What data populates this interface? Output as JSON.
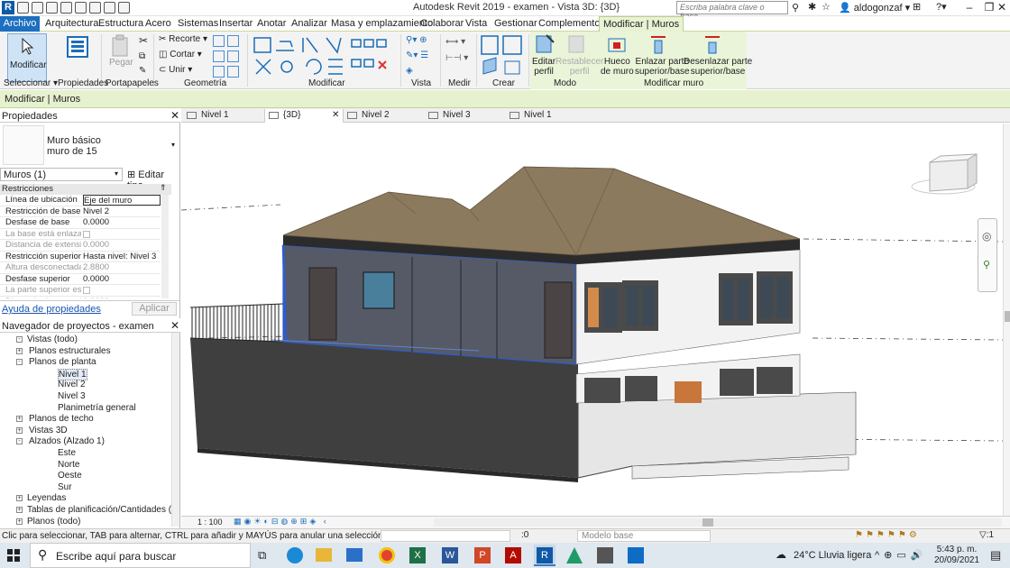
{
  "app": {
    "title": "Autodesk Revit 2019 - examen - Vista 3D: {3D}",
    "search_placeholder": "Escriba palabra clave o frase",
    "user": "aldogonzaf"
  },
  "menu": {
    "tabs": [
      "Archivo",
      "Arquitectura",
      "Estructura",
      "Acero",
      "Sistemas",
      "Insertar",
      "Anotar",
      "Analizar",
      "Masa y emplazamiento",
      "Colaborar",
      "Vista",
      "Gestionar",
      "Complementos",
      "Modificar | Muros"
    ],
    "active": "Modificar | Muros"
  },
  "ribbon": {
    "modificar_label": "Modificar",
    "pegar_label": "Pegar",
    "recorte_label": "Recorte",
    "cortar_label": "Cortar",
    "unir_label": "Unir",
    "editar_perfil": "Editar\nperfil",
    "restablecer_perfil": "Restablecer\nperfil",
    "hueco_muro": "Hueco\nde muro",
    "enlazar": "Enlazar parte\nsuperior/base",
    "desenlazar": "Desenlazar parte\nsuperior/base",
    "groups": {
      "seleccionar": "Seleccionar",
      "propiedades": "Propiedades",
      "portapapeles": "Portapapeles",
      "geometria": "Geometría",
      "modificar": "Modificar",
      "vista": "Vista",
      "medir": "Medir",
      "crear": "Crear",
      "modo": "Modo",
      "modificar_muro": "Modificar muro"
    }
  },
  "context_bar": "Modificar | Muros",
  "properties": {
    "title": "Propiedades",
    "type_name": "Muro básico",
    "type_sub": "muro de 15",
    "selector": "Muros (1)",
    "edit_type": "Editar tipo",
    "section": "Restricciones",
    "rows": [
      {
        "k": "Línea de ubicación",
        "v": "Eje del muro",
        "dim": false
      },
      {
        "k": "Restricción de base",
        "v": "Nivel 2",
        "dim": false
      },
      {
        "k": "Desfase de base",
        "v": "0.0000",
        "dim": false
      },
      {
        "k": "La base está enlazada",
        "v": "",
        "dim": true
      },
      {
        "k": "Distancia de extensi...",
        "v": "0.0000",
        "dim": true
      },
      {
        "k": "Restricción superior",
        "v": "Hasta nivel: Nivel 3",
        "dim": false
      },
      {
        "k": "Altura desconectada",
        "v": "2.8800",
        "dim": true
      },
      {
        "k": "Desfase superior",
        "v": "0.0000",
        "dim": false
      },
      {
        "k": "La parte superior est...",
        "v": "",
        "dim": true
      },
      {
        "k": "Distancia de extensi...",
        "v": "0.0000",
        "dim": true
      }
    ],
    "help_link": "Ayuda de propiedades",
    "apply": "Aplicar"
  },
  "browser": {
    "title": "Navegador de proyectos - examen",
    "items": [
      {
        "label": "Vistas (todo)",
        "level": 0,
        "exp": "-"
      },
      {
        "label": "Planos estructurales",
        "level": 1,
        "exp": "+"
      },
      {
        "label": "Planos de planta",
        "level": 1,
        "exp": "-"
      },
      {
        "label": "Nivel 1",
        "level": 2,
        "exp": ""
      },
      {
        "label": "Nivel 2",
        "level": 2,
        "exp": ""
      },
      {
        "label": "Nivel 3",
        "level": 2,
        "exp": ""
      },
      {
        "label": "Planimetría general",
        "level": 2,
        "exp": ""
      },
      {
        "label": "Planos de techo",
        "level": 1,
        "exp": "+"
      },
      {
        "label": "Vistas 3D",
        "level": 1,
        "exp": "+"
      },
      {
        "label": "Alzados (Alzado 1)",
        "level": 1,
        "exp": "-"
      },
      {
        "label": "Este",
        "level": 2,
        "exp": ""
      },
      {
        "label": "Norte",
        "level": 2,
        "exp": ""
      },
      {
        "label": "Oeste",
        "level": 2,
        "exp": ""
      },
      {
        "label": "Sur",
        "level": 2,
        "exp": ""
      },
      {
        "label": "Leyendas",
        "level": 0,
        "exp": "+"
      },
      {
        "label": "Tablas de planificación/Cantidades (todo)",
        "level": 0,
        "exp": "+"
      },
      {
        "label": "Planos (todo)",
        "level": 0,
        "exp": "+"
      }
    ]
  },
  "view_tabs": [
    {
      "label": "Nivel 1",
      "active": false
    },
    {
      "label": "{3D}",
      "active": true
    },
    {
      "label": "Nivel 2",
      "active": false
    },
    {
      "label": "Nivel 3",
      "active": false
    },
    {
      "label": "Nivel 1",
      "active": false
    }
  ],
  "viewbar": {
    "scale": "1 : 100"
  },
  "status": {
    "hint": "Clic para seleccionar, TAB para alternar, CTRL para añadir y MAYÚS para anular una selección.",
    "zero": ":0",
    "model": "Modelo base",
    "filter": "▽:1"
  },
  "taskbar": {
    "search": "Escribe aquí para buscar",
    "weather": "24°C  Lluvia ligera",
    "time": "5:43 p. m.",
    "date": "20/09/2021"
  },
  "colors": {
    "ribbon_green": "#eaf4d8",
    "archivo_blue": "#1d6fbf",
    "selection": "#2b5cd6",
    "roof": "#8c7a5e"
  }
}
